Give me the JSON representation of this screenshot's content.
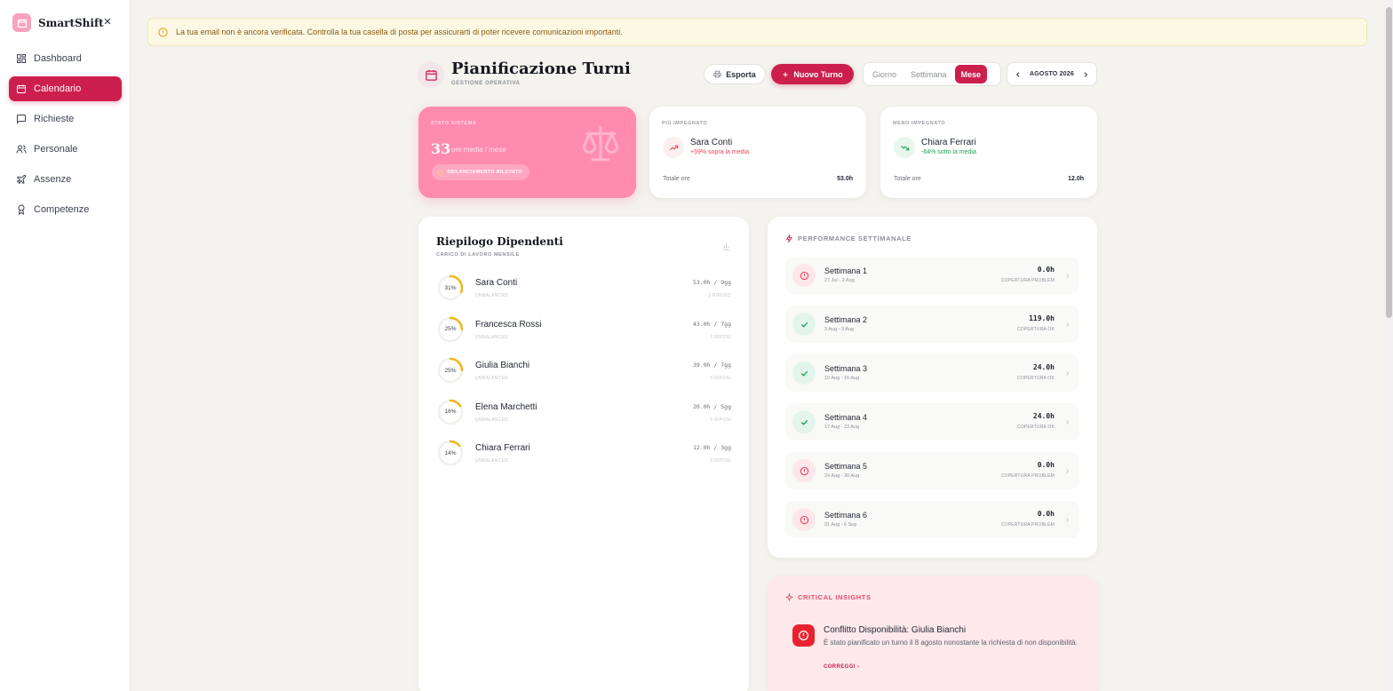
{
  "app": {
    "name": "SmartShift"
  },
  "sidebar": {
    "items": [
      {
        "label": "Dashboard",
        "icon": "grid-icon"
      },
      {
        "label": "Calendario",
        "icon": "calendar-icon",
        "active": true
      },
      {
        "label": "Richieste",
        "icon": "chat-icon"
      },
      {
        "label": "Personale",
        "icon": "users-icon"
      },
      {
        "label": "Assenze",
        "icon": "plane-icon"
      },
      {
        "label": "Competenze",
        "icon": "award-icon"
      }
    ]
  },
  "banner": {
    "text": "La tua email non è ancora verificata. Controlla la tua casella di posta per assicurarti di poter ricevere comunicazioni importanti."
  },
  "header": {
    "title": "Pianificazione Turni",
    "subtitle": "GESTIONE OPERATIVA",
    "export_label": "Esporta",
    "new_shift_label": "Nuovo Turno",
    "views": [
      "Giorno",
      "Settimana",
      "Mese"
    ],
    "active_view": "Mese",
    "month": "AGOSTO 2026"
  },
  "stats": {
    "system": {
      "label": "STATO SISTEMA",
      "value": "33",
      "unit": "ore media / mese",
      "badge": "SBILANCIAMENTO RILEVATO"
    },
    "busiest": {
      "label": "PIÙ IMPEGNATO",
      "name": "Sara Conti",
      "delta": "+59% sopra la media",
      "total_label": "Totale ore",
      "total": "53.0h"
    },
    "least": {
      "label": "MENO IMPEGNATO",
      "name": "Chiara Ferrari",
      "delta": "-64% sotto la media",
      "total_label": "Totale ore",
      "total": "12.0h"
    }
  },
  "employees": {
    "title": "Riepilogo Dipendenti",
    "subtitle": "CARICO DI LAVORO MENSILE",
    "rows": [
      {
        "pct": "31%",
        "pct_value": 31,
        "name": "Sara Conti",
        "status": "UNBALANCED",
        "hours": "53.0h / 9gg",
        "note": "1 RIPOSO"
      },
      {
        "pct": "25%",
        "pct_value": 25,
        "name": "Francesca Rossi",
        "status": "UNBALANCED",
        "hours": "43.0h / 7gg",
        "note": "0 RIPOSI"
      },
      {
        "pct": "25%",
        "pct_value": 25,
        "name": "Giulia Bianchi",
        "status": "UNBALANCED",
        "hours": "39.0h / 7gg",
        "note": "0 RIPOSI"
      },
      {
        "pct": "16%",
        "pct_value": 16,
        "name": "Elena Marchetti",
        "status": "UNBALANCED",
        "hours": "20.0h / 5gg",
        "note": "0 RIPOSI"
      },
      {
        "pct": "14%",
        "pct_value": 14,
        "name": "Chiara Ferrari",
        "status": "UNBALANCED",
        "hours": "12.0h / 3gg",
        "note": "0 RIPOSI"
      }
    ]
  },
  "performance": {
    "title": "PERFORMANCE SETTIMANALE",
    "weeks": [
      {
        "name": "Settimana 1",
        "range": "27 Jul - 2 Aug",
        "hours": "0.0h",
        "status": "COPERTURA PROBLEM",
        "ok": false
      },
      {
        "name": "Settimana 2",
        "range": "3 Aug - 9 Aug",
        "hours": "119.0h",
        "status": "COPERTURA OK",
        "ok": true
      },
      {
        "name": "Settimana 3",
        "range": "10 Aug - 16 Aug",
        "hours": "24.0h",
        "status": "COPERTURA OK",
        "ok": true
      },
      {
        "name": "Settimana 4",
        "range": "17 Aug - 23 Aug",
        "hours": "24.0h",
        "status": "COPERTURA OK",
        "ok": true
      },
      {
        "name": "Settimana 5",
        "range": "24 Aug - 30 Aug",
        "hours": "0.0h",
        "status": "COPERTURA PROBLEM",
        "ok": false
      },
      {
        "name": "Settimana 6",
        "range": "31 Aug - 6 Sep",
        "hours": "0.0h",
        "status": "COPERTURA PROBLEM",
        "ok": false
      }
    ]
  },
  "insights": {
    "title": "CRITICAL INSIGHTS",
    "item_title": "Conflitto Disponibilità: Giulia Bianchi",
    "item_body": "È stato pianificato un turno il 8 agosto nonostante la richiesta di non disponibilità.",
    "action": "CORREGGI"
  },
  "colors": {
    "accent": "#cc1f4e",
    "pink": "#ff8caf",
    "ring": "#f2b51c",
    "ok": "#22a35a",
    "problem": "#e8435a"
  }
}
